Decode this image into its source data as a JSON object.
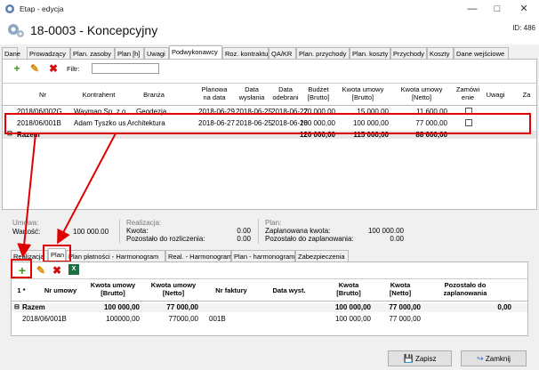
{
  "window": {
    "title": "Etap - edycja",
    "minimize": "—",
    "maximize": "□",
    "close": "✕"
  },
  "header": {
    "title": "18-0003 - Koncepcyjny",
    "id_label": "ID: 486"
  },
  "tabs": [
    "Dane",
    "Prowadzący",
    "Plan. zasoby",
    "Plan [h]",
    "Uwagi",
    "Podwykonawcy",
    "Roz. kontraktu",
    "QA/KR",
    "Plan. przychody",
    "Plan. koszty",
    "Przychody",
    "Koszty",
    "Dane wejściowe"
  ],
  "toolbar": {
    "filter_label": "Filtr:",
    "filter_value": ""
  },
  "top_grid": {
    "headers": [
      "Nr",
      "Kontrahent",
      "Branża",
      "Planowa\nna data",
      "Data\nwysłania",
      "Data\nodebrani",
      "Budżet\n[Brutto]",
      "Kwota umowy\n[Brutto]",
      "Kwota umowy\n[Netto]",
      "Zamówi\nenie",
      "Uwagi",
      "Za"
    ],
    "rows": [
      [
        "2018/06/002G",
        "Wayman Sp. z.o",
        "Geodezja",
        "2018-06-29",
        "2018-06-25",
        "2018-06-27",
        "20 000,00",
        "15 000,00",
        "11 600,00"
      ],
      [
        "2018/06/001B",
        "Adam Tyszko us",
        "Architektura",
        "2018-06-27",
        "2018-06-25",
        "2018-06-28",
        "100 000,00",
        "100 000,00",
        "77 000,00"
      ]
    ],
    "total_label": "Razem",
    "totals": [
      "120 000,00",
      "115 000,00",
      "88 600,00"
    ]
  },
  "summary": {
    "umowa_label": "Umowa:",
    "wartosc_label": "Wartość:",
    "wartosc_value": "100 000.00",
    "realizacja_label": "Realizacja:",
    "kwota_label": "Kwota:",
    "kwota_value": "0.00",
    "pozostalo_rozl_label": "Pozostało do rozliczenia:",
    "pozostalo_rozl_value": "0.00",
    "plan_label": "Plan:",
    "plan_kwota_label": "Zaplanowana kwota:",
    "plan_kwota_value": "100 000.00",
    "pozostalo_plan_label": "Pozostało do zaplanowania:",
    "pozostalo_plan_value": "0.00"
  },
  "subtabs": [
    "Realizacja",
    "Plan",
    "Plan płatności - Harmonogram",
    "Real. - Harmonogram",
    "Plan - harmonogram",
    "Zabezpieczenia"
  ],
  "bottom_grid": {
    "headers": [
      "1 *",
      "Nr umowy",
      "Kwota umowy\n[Brutto]",
      "Kwota umowy\n[Netto]",
      "Nr faktury",
      "Data wyst.",
      "Kwota\n[Brutto]",
      "Kwota\n[Netto]",
      "Pozostało do\nzaplanowania"
    ],
    "total_label": "Razem",
    "totals": [
      "100 000,00",
      "77 000,00",
      "100 000,00",
      "77 000,00",
      "0,00"
    ],
    "rows": [
      [
        "2018/06/001B",
        "100000,00",
        "77000,00",
        "001B",
        "",
        "100 000,00",
        "77 000,00"
      ]
    ]
  },
  "footer": {
    "save_label": "Zapisz",
    "close_label": "Zamknij"
  },
  "colors": {
    "highlight": "#e00000",
    "add": "#3a9a1a",
    "delete": "#d01010",
    "excel": "#1d6f42"
  }
}
